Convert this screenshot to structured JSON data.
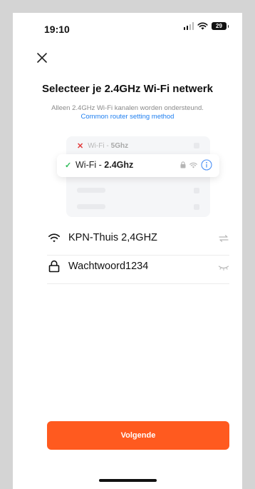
{
  "status_bar": {
    "time": "19:10",
    "battery": "29"
  },
  "header": {
    "close_icon": "close-icon",
    "title": "Selecteer je 2.4GHz Wi-Fi netwerk",
    "subtitle": "Alleen 2.4GHz Wi-Fi kanalen worden ondersteund.",
    "help_link": "Common router setting method"
  },
  "illustration": {
    "bad_network": {
      "prefix": "Wi-Fi - ",
      "band": "5Ghz",
      "mark": "✕"
    },
    "good_network": {
      "prefix": "Wi-Fi - ",
      "band": "2.4Ghz",
      "mark": "✓"
    }
  },
  "form": {
    "network": {
      "icon": "wifi-icon",
      "value": "KPN-Thuis 2,4GHZ",
      "action_icon": "switch-network-icon"
    },
    "password": {
      "icon": "lock-icon",
      "value": "Wachtwoord1234",
      "action_icon": "eye-closed-icon"
    }
  },
  "actions": {
    "next_label": "Volgende"
  },
  "colors": {
    "accent": "#ff5a1f",
    "link": "#1f7ff0",
    "success": "#2ebd59",
    "error": "#e23b3b"
  }
}
